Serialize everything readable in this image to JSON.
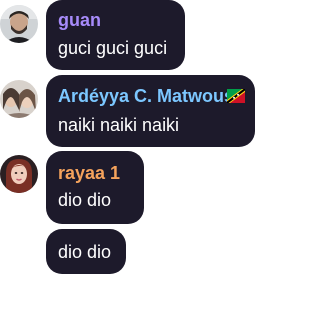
{
  "chat": {
    "messages": [
      {
        "username": "guan",
        "name_color": "#a78bfa",
        "avatar": "profile-photo-man-with-beard",
        "text": "guci guci guci"
      },
      {
        "username": "Ardéyya C. Matwous",
        "name_color": "#7cc7ff",
        "avatar": "profile-photo-two-women",
        "flag": "saint-kitts-and-nevis-flag-icon",
        "text": "naiki naiki naiki"
      },
      {
        "username": "rayaa 1",
        "name_color": "#f5a35c",
        "avatar": "profile-photo-woman-red-hair",
        "text": "dio dio"
      },
      {
        "text": "dio dio"
      }
    ]
  },
  "colors": {
    "bubble": "#1d1a2b",
    "message_text": "#ffffff",
    "page_bg": "#ffffff"
  }
}
